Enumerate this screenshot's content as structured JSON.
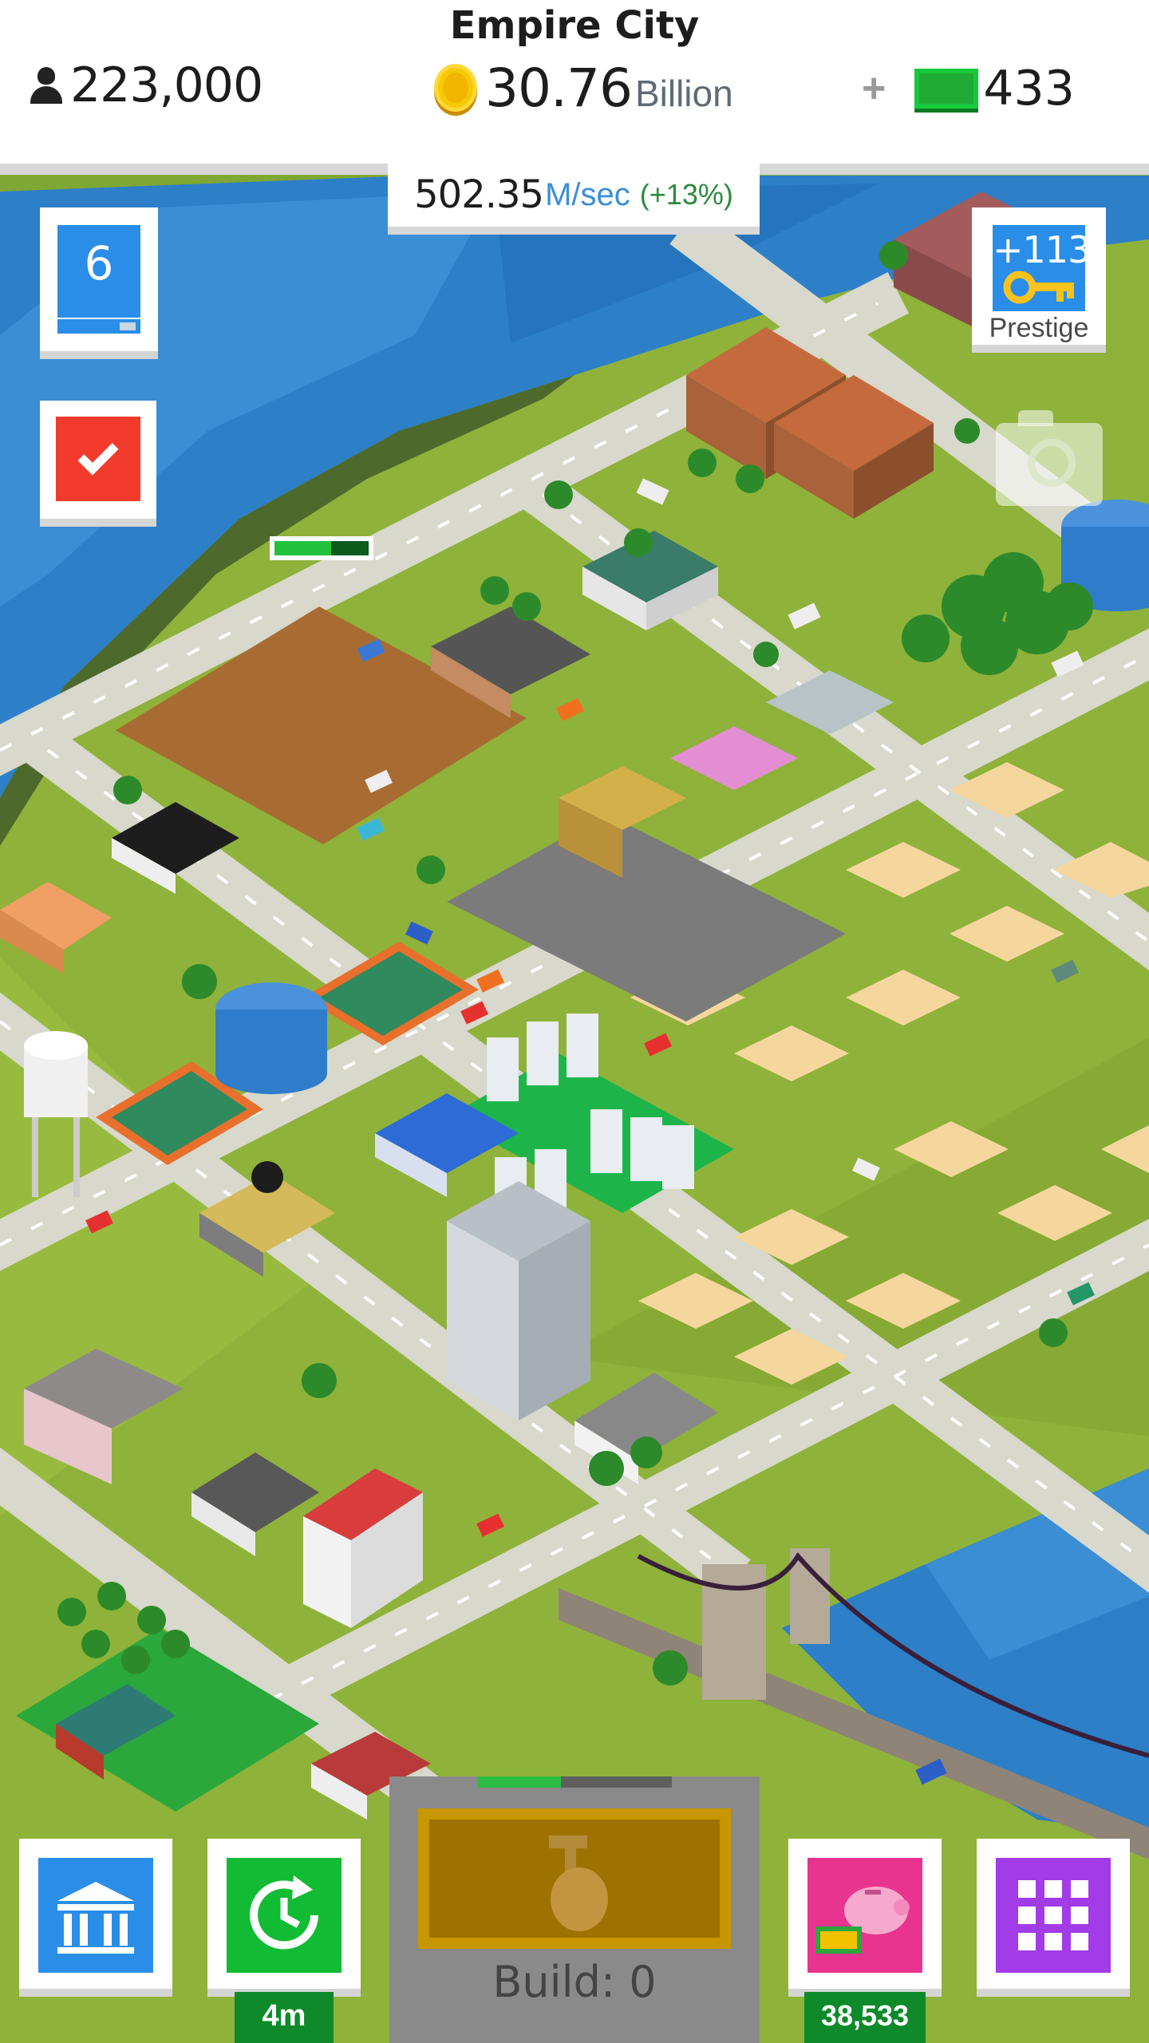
{
  "header": {
    "city_name": "Empire City",
    "population": "223,000",
    "population_icon": "person-icon",
    "money_value": "30.76",
    "money_unit": "Billion",
    "money_icon": "coin-icon",
    "cash_plus": "+",
    "cash_value": "433",
    "cash_icon": "banknote-icon"
  },
  "income": {
    "rate_value": "502.35",
    "rate_unit": "M/sec",
    "rate_bonus": "(+13%)"
  },
  "level": {
    "value": "6",
    "progress_fraction": 0.78
  },
  "tasks": {
    "icon": "checkmark-icon"
  },
  "prestige": {
    "value": "+113",
    "label": "Prestige",
    "icon": "key-icon"
  },
  "camera": {
    "icon": "camera-icon"
  },
  "construction_progress_fraction": 0.6,
  "bottom_bar": {
    "bank": {
      "icon": "bank-icon"
    },
    "boost": {
      "icon": "clock-boost-icon",
      "timer": "4m"
    },
    "build": {
      "label": "Build: 0",
      "progress_fraction": 0.43,
      "icon": "build-hammer-hand-icon"
    },
    "piggy": {
      "icon": "piggy-bank-icon",
      "value": "38,533"
    },
    "grid": {
      "icon": "grid-menu-icon"
    }
  },
  "colors": {
    "accent_blue": "#2a8ee8",
    "task_red": "#f23b2c",
    "boost_green": "#11bb33",
    "piggy_pink": "#e8348f",
    "grid_purple": "#a23be8",
    "water": "#2d7fc8",
    "grass": "#8fb23a",
    "road": "#d8d8cc"
  }
}
